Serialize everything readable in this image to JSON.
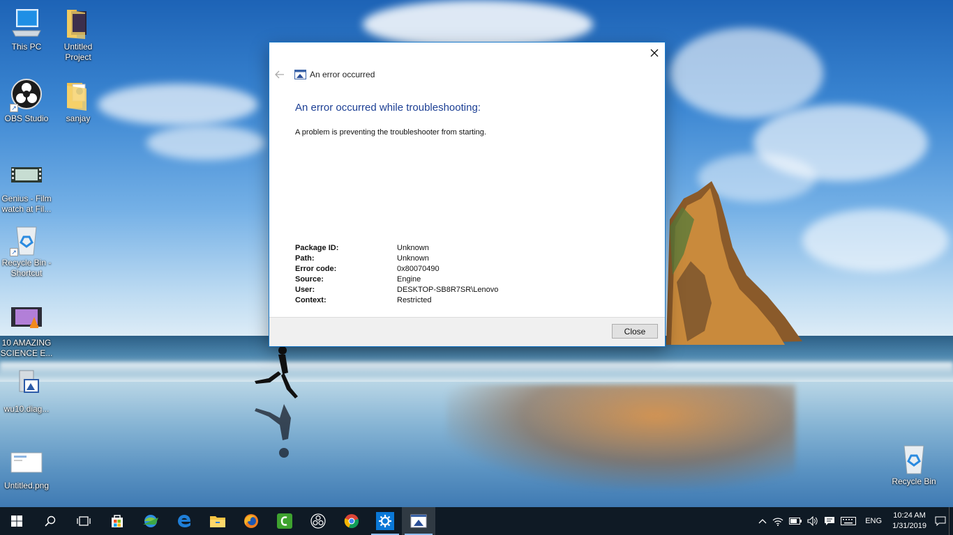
{
  "desktop": {
    "icons": [
      {
        "label": "This PC",
        "icon": "computer-icon"
      },
      {
        "label": "Untitled\nProject",
        "icon": "folder-icon"
      },
      {
        "label": "OBS Studio",
        "icon": "obs-icon"
      },
      {
        "label": "sanjay",
        "icon": "folder-icon"
      },
      {
        "label": "Genius - Film\nwatch at Fil...",
        "icon": "video-file-icon"
      },
      {
        "label": "Recycle Bin -\nShortcut",
        "icon": "recycle-bin-icon"
      },
      {
        "label": "10 AMAZING\nSCIENCE E...",
        "icon": "vlc-video-icon"
      },
      {
        "label": "wu10.diag...",
        "icon": "diagcab-icon"
      },
      {
        "label": "Untitled.png",
        "icon": "image-file-icon"
      },
      {
        "label": "Recycle Bin",
        "icon": "recycle-bin-icon"
      }
    ]
  },
  "dialog": {
    "nav_title": "An error occurred",
    "heading": "An error occurred while troubleshooting:",
    "message": "A problem is preventing the troubleshooter from starting.",
    "details": [
      {
        "key": "Package ID:",
        "value": "Unknown"
      },
      {
        "key": "Path:",
        "value": "Unknown"
      },
      {
        "key": "Error code:",
        "value": "0x80070490"
      },
      {
        "key": "Source:",
        "value": "Engine"
      },
      {
        "key": "User:",
        "value": "DESKTOP-SB8R7SR\\Lenovo"
      },
      {
        "key": "Context:",
        "value": "Restricted"
      }
    ],
    "close_label": "Close",
    "accent_color": "#1c3f94",
    "border_color": "#1979ca"
  },
  "taskbar": {
    "apps": [
      "start-icon",
      "search-icon",
      "task-view-icon",
      "store-icon",
      "idm-icon",
      "edge-icon",
      "file-explorer-icon",
      "firefox-icon",
      "camtasia-icon",
      "obs-icon",
      "chrome-icon",
      "settings-icon",
      "troubleshooter-icon"
    ],
    "language": "ENG",
    "time": "10:24 AM",
    "date": "1/31/2019"
  }
}
